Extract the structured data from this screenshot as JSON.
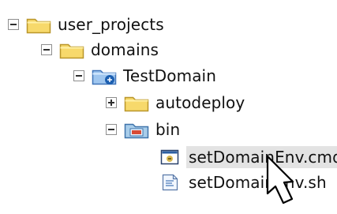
{
  "tree": {
    "items": [
      {
        "label": "user_projects",
        "expanded": true,
        "icon": "folder-icon",
        "level": 0
      },
      {
        "label": "domains",
        "expanded": true,
        "icon": "folder-icon",
        "level": 1
      },
      {
        "label": "TestDomain",
        "expanded": true,
        "icon": "domain-folder-icon",
        "level": 2
      },
      {
        "label": "autodeploy",
        "expanded": false,
        "icon": "folder-icon",
        "level": 3
      },
      {
        "label": "bin",
        "expanded": true,
        "icon": "bin-folder-icon",
        "level": 3
      },
      {
        "label": "setDomainEnv.cmd",
        "icon": "cmd-file-icon",
        "selected": true,
        "level": 4
      },
      {
        "label": "setDomainEnv.sh",
        "icon": "sh-file-icon",
        "selected": false,
        "level": 4
      }
    ]
  },
  "colors": {
    "folder": "#f7d96b",
    "folder_border": "#b9962a",
    "selection": "#e3e3e3",
    "toggle_border": "#8e8e8e"
  }
}
